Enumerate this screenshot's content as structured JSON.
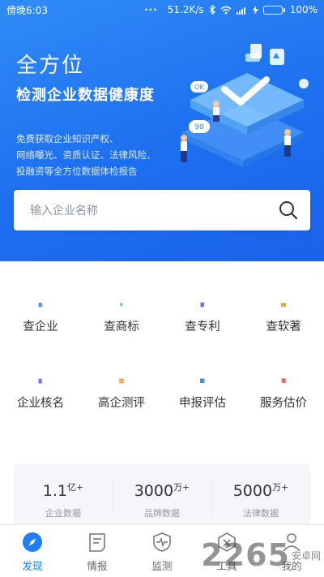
{
  "status_bar": {
    "time": "傍晚6:03",
    "dots": "···",
    "speed": "51.2K/s",
    "battery": "100%",
    "battery_level": 1.0
  },
  "hero": {
    "title": "全方位",
    "subtitle": "检测企业数据健康度",
    "description": [
      "免费获取企业知识产权、",
      "网络曝光、资质认证、法律风险、",
      "投融资等全方位数据体检报告"
    ],
    "bubble_ok": "OK",
    "bubble_98": "98"
  },
  "search": {
    "placeholder": "输入企业名称",
    "icon": "search-icon"
  },
  "grid": [
    {
      "label": "查企业",
      "icon": "building-icon",
      "color": "#2b7de9"
    },
    {
      "label": "查商标",
      "icon": "trademark-r-icon",
      "color": "#1aa66a"
    },
    {
      "label": "查专利",
      "icon": "patent-doc-icon",
      "color": "#5b63e6"
    },
    {
      "label": "查软著",
      "icon": "code-doc-icon",
      "color": "#f0982a"
    },
    {
      "label": "企业核名",
      "icon": "name-check-icon",
      "color": "#5b63e6"
    },
    {
      "label": "高企测评",
      "icon": "high-tech-icon",
      "color": "#f39a2a"
    },
    {
      "label": "申报评估",
      "icon": "trend-chart-icon",
      "color": "#2b7de9"
    },
    {
      "label": "服务估价",
      "icon": "yuan-price-icon",
      "color": "#ef4c4c"
    }
  ],
  "stats": [
    {
      "value": "1.1",
      "unit": "亿+",
      "caption": "企业数据"
    },
    {
      "value": "3000",
      "unit": "万+",
      "caption": "品牌数据"
    },
    {
      "value": "5000",
      "unit": "万+",
      "caption": "法律数据"
    }
  ],
  "tabs": [
    {
      "label": "发现",
      "icon": "compass-icon",
      "active": true
    },
    {
      "label": "情报",
      "icon": "report-icon",
      "active": false
    },
    {
      "label": "监测",
      "icon": "shield-pulse-icon",
      "active": false
    },
    {
      "label": "工具",
      "icon": "tool-icon",
      "active": false
    },
    {
      "label": "我的",
      "icon": "user-icon",
      "active": false
    }
  ],
  "watermark": {
    "big": "2265",
    "small": "安卓网"
  },
  "colors": {
    "accent": "#1e7ef2",
    "hero_bg": "#1e6ff0"
  }
}
